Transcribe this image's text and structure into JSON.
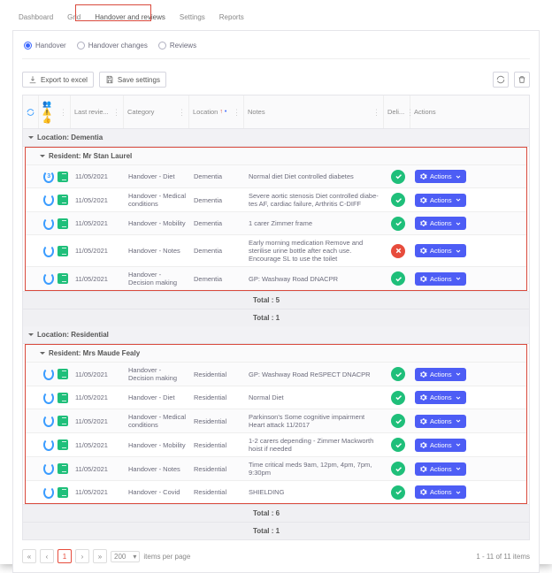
{
  "nav": {
    "tabs": [
      "Dashboard",
      "Grid",
      "Handover and reviews",
      "Settings",
      "Reports"
    ],
    "activeIndex": 2
  },
  "subtabs": {
    "options": [
      "Handover",
      "Handover changes",
      "Reviews"
    ],
    "selectedIndex": 0
  },
  "toolbar": {
    "export": "Export to excel",
    "save": "Save settings"
  },
  "columns": {
    "lastReview": "Last revie...",
    "category": "Category",
    "location": "Location",
    "notes": "Notes",
    "deli": "Deli...",
    "actions": "Actions"
  },
  "iconcol": "👥 ⚠️ 👍",
  "groups": [
    {
      "location": "Location: Dementia",
      "resident": "Resident: Mr Stan Laurel",
      "rows": [
        {
          "spin": "3",
          "date": "11/05/2021",
          "category": "Handover - Diet",
          "location": "Dementia",
          "notes": "Normal diet Diet controlled diabetes",
          "status": "ok"
        },
        {
          "spin": "",
          "date": "11/05/2021",
          "category": "Handover - Medical conditions",
          "location": "Dementia",
          "notes": "Severe aortic stenosis Diet controlled diabe-tes AF, cardiac failure, Arthritis C-DIFF",
          "status": "ok"
        },
        {
          "spin": "",
          "date": "11/05/2021",
          "category": "Handover - Mobility",
          "location": "Dementia",
          "notes": "1 carer Zimmer frame",
          "status": "ok"
        },
        {
          "spin": "",
          "date": "11/05/2021",
          "category": "Handover - Notes",
          "location": "Dementia",
          "notes": "Early morning medication Remove and sterilise urine bottle after each use. Encourage SL to use the toilet",
          "status": "bad"
        },
        {
          "spin": "",
          "date": "11/05/2021",
          "category": "Handover - Decision making",
          "location": "Dementia",
          "notes": "GP: Washway Road DNACPR",
          "status": "ok"
        }
      ],
      "total1": "Total : 5",
      "total2": "Total : 1"
    },
    {
      "location": "Location: Residential",
      "resident": "Resident: Mrs Maude Fealy",
      "rows": [
        {
          "spin": "",
          "date": "11/05/2021",
          "category": "Handover - Decision making",
          "location": "Residential",
          "notes": "GP: Washway Road ReSPECT DNACPR",
          "status": "ok"
        },
        {
          "spin": "",
          "date": "11/05/2021",
          "category": "Handover - Diet",
          "location": "Residential",
          "notes": "Normal Diet",
          "status": "ok"
        },
        {
          "spin": "",
          "date": "11/05/2021",
          "category": "Handover - Medical conditions",
          "location": "Residential",
          "notes": "Parkinson's Some cognitive impairment Heart attack 11/2017",
          "status": "ok"
        },
        {
          "spin": "",
          "date": "11/05/2021",
          "category": "Handover - Mobility",
          "location": "Residential",
          "notes": "1-2 carers depending - Zimmer Mackworth hoist if needed",
          "status": "ok"
        },
        {
          "spin": "",
          "date": "11/05/2021",
          "category": "Handover - Notes",
          "location": "Residential",
          "notes": "Time critical meds 9am, 12pm, 4pm, 7pm, 9:30pm",
          "status": "ok"
        },
        {
          "spin": "",
          "date": "11/05/2021",
          "category": "Handover - Covid",
          "location": "Residential",
          "notes": "SHIELDING",
          "status": "ok"
        }
      ],
      "total1": "Total : 6",
      "total2": "Total : 1"
    }
  ],
  "actionLabel": "Actions",
  "pager": {
    "page": "1",
    "size": "200",
    "perPage": "items per page",
    "info": "1 - 11 of 11 items"
  }
}
